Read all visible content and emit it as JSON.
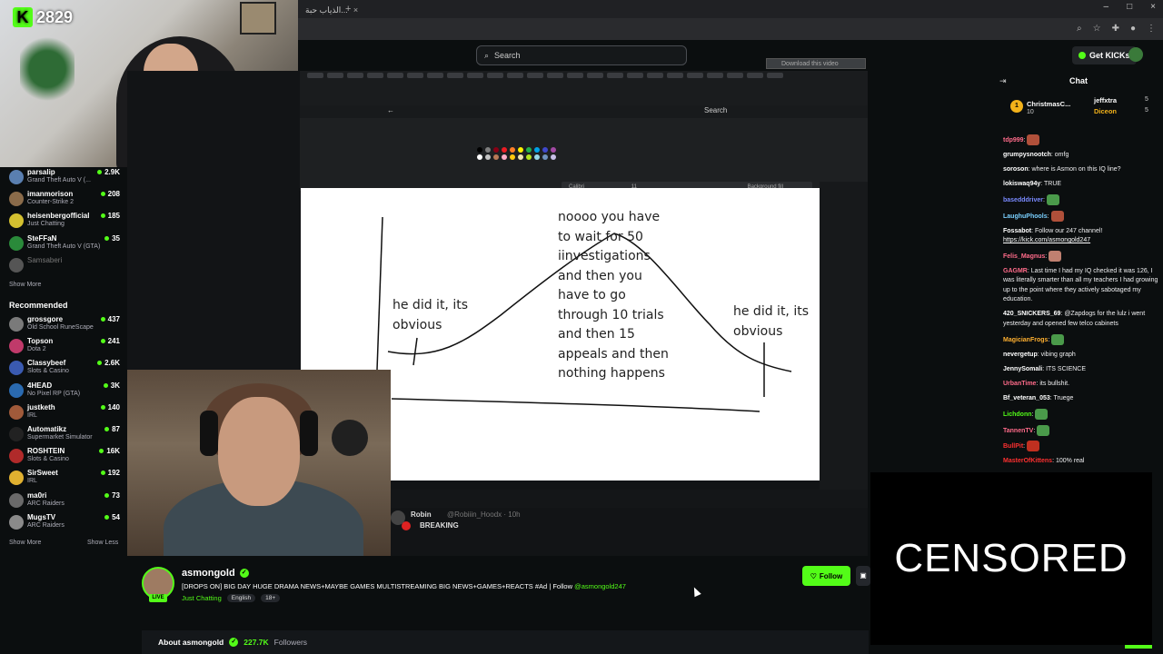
{
  "kicks": {
    "count": "2829"
  },
  "browser": {
    "tab_title": "الذياب حبة...",
    "tab_close": "×",
    "new_tab": "+",
    "min": "–",
    "max": "□",
    "close": "×"
  },
  "topbar": {
    "search_placeholder": "Search",
    "get_kicks": "Get KICKs"
  },
  "sidebar": {
    "following": [
      {
        "name": "parsalip",
        "category": "Grand Theft Auto V (...",
        "viewers": "2.9K",
        "color": "#5a7fb0"
      },
      {
        "name": "imanmorison",
        "category": "Counter-Strike 2",
        "viewers": "208",
        "color": "#8a6b4a"
      },
      {
        "name": "heisenbergofficial",
        "category": "Just Chatting",
        "viewers": "185",
        "color": "#d4c030"
      },
      {
        "name": "SteFFaN",
        "category": "Grand Theft Auto V (GTA)",
        "viewers": "35",
        "color": "#2a8a3a"
      },
      {
        "name": "Samsaberi",
        "category": "",
        "viewers": "",
        "color": "#555555"
      }
    ],
    "show_more_1": "Show More",
    "recommended_title": "Recommended",
    "recommended": [
      {
        "name": "grossgore",
        "category": "Old School RuneScape",
        "viewers": "437",
        "color": "#7a7a7a"
      },
      {
        "name": "Topson",
        "category": "Dota 2",
        "viewers": "241",
        "color": "#c03a6a"
      },
      {
        "name": "Classybeef",
        "category": "Slots & Casino",
        "viewers": "2.6K",
        "color": "#3a5ab0"
      },
      {
        "name": "4HEAD",
        "category": "No Pixel RP (GTA)",
        "viewers": "3K",
        "color": "#2a6ab0"
      },
      {
        "name": "justketh",
        "category": "IRL",
        "viewers": "140",
        "color": "#a05a3a"
      },
      {
        "name": "Automatikz",
        "category": "Supermarket Simulator",
        "viewers": "87",
        "color": "#222222"
      },
      {
        "name": "ROSHTEIN",
        "category": "Slots & Casino",
        "viewers": "16K",
        "color": "#b02a2a"
      },
      {
        "name": "SirSweet",
        "category": "IRL",
        "viewers": "192",
        "color": "#e0b030"
      },
      {
        "name": "ma0ri",
        "category": "ARC Raiders",
        "viewers": "73",
        "color": "#6a6a6a"
      },
      {
        "name": "MugsTV",
        "category": "ARC Raiders",
        "viewers": "54",
        "color": "#8a8a8a"
      }
    ],
    "show_more_2": "Show More",
    "show_less": "Show Less"
  },
  "video": {
    "download_badge": "Download this video",
    "paint_search": "Search",
    "font_name": "Calibri",
    "font_size": "11",
    "bg_fill": "Background fill",
    "canvas": {
      "left_text": "he did it, its\nobvious",
      "middle_text": "noooo you have\nto wait for 50\niinvestigations\nand then you\nhave to go\nthrough 10 trials\nand then 15\nappeals and then\nnothing happens",
      "right_text": "he did it, its\nobvious"
    },
    "tweet_name": "Robin",
    "tweet_handle": "@Robiiin_Hoodx · 10h",
    "tweet_text": "BREAKING",
    "paint_colors": [
      "#000000",
      "#7f7f7f",
      "#880015",
      "#ed1c24",
      "#ff7f27",
      "#fff200",
      "#22b14c",
      "#00a2e8",
      "#3f48cc",
      "#a349a4",
      "#ffffff",
      "#c3c3c3",
      "#b97a57",
      "#ffaec9",
      "#ffc90e",
      "#efe4b0",
      "#b5e61d",
      "#99d9ea",
      "#7092be",
      "#c8bfe7"
    ]
  },
  "stream": {
    "streamer": "asmongold",
    "live": "LIVE",
    "title": "[DROPS ON] BIG DAY HUGE DRAMA NEWS+MAYBE GAMES MULTISTREAMING BIG NEWS+GAMES+REACTS #Ad | Follow ",
    "title_handle": "@asmongold247",
    "category": "Just Chatting",
    "tags": [
      "English",
      "18+"
    ],
    "follow_label": "Follow",
    "about_label": "About asmongold",
    "followers_count": "227.7K",
    "followers_label": "Followers"
  },
  "chat": {
    "title": "Chat",
    "pinned": {
      "rank": "1",
      "name1": "ChristmasC...",
      "count1": "10",
      "name2": "jeffxtra",
      "count2": "5",
      "name3": "Diceon",
      "count3": "5"
    },
    "messages": [
      {
        "user": "tdp999",
        "color": "#ff6b8a",
        "text": "",
        "emote": "#b0503a"
      },
      {
        "user": "grumpysnootch",
        "color": "#ffffff",
        "text": "omfg",
        "emote": ""
      },
      {
        "user": "soroson",
        "color": "#ffffff",
        "text": "where is Asmon on this IQ line?",
        "emote": ""
      },
      {
        "user": "lokiswaq94y",
        "color": "#ffffff",
        "text": "TRUE",
        "emote": ""
      },
      {
        "user": "basedddriver",
        "color": "#7a8aff",
        "text": "",
        "emote": "#4a9a4a"
      },
      {
        "user": "LaughuPhools",
        "color": "#7ad0ff",
        "text": "",
        "emote": "#b0503a"
      },
      {
        "user": "Fossabot",
        "color": "#ffffff",
        "text": "Follow our 247 channel! ",
        "link": "https://kick.com/asmongold247",
        "emote": ""
      },
      {
        "user": "Felis_Magnus",
        "color": "#ff6b8a",
        "text": "",
        "emote": "#c08070"
      },
      {
        "user": "GAGMR",
        "color": "#ff6b8a",
        "text": "Last time I had my IQ checked it was 126, I was literally smarter than all my teachers I had growing up to the point where they actively sabotaged my education.",
        "emote": ""
      },
      {
        "user": "420_SNICKERS_69",
        "color": "#ffffff",
        "text": "@Zapdogs for the lulz i went yesterday and opened few telco cabinets",
        "emote": ""
      },
      {
        "user": "MagicianFrogs",
        "color": "#ffb030",
        "text": "",
        "emote": "#4a9a4a"
      },
      {
        "user": "nevergetup",
        "color": "#ffffff",
        "text": "vibing graph",
        "emote": ""
      },
      {
        "user": "JennySomali",
        "color": "#ffffff",
        "text": "ITS SCIENCE",
        "emote": ""
      },
      {
        "user": "UrbanTime",
        "color": "#ff6b8a",
        "text": "its bullshit.",
        "emote": ""
      },
      {
        "user": "Bf_veteran_053",
        "color": "#ffffff",
        "text": "Truege",
        "emote": ""
      },
      {
        "user": "Lichdonn",
        "color": "#53fc18",
        "text": "",
        "emote": "#4a9a4a"
      },
      {
        "user": "TannenTV",
        "color": "#ff6b8a",
        "text": "",
        "emote": "#4a9a4a"
      },
      {
        "user": "BullPit",
        "color": "#ff3030",
        "text": "",
        "emote": "#c03020"
      },
      {
        "user": "MasterOfKittens",
        "color": "#ff3030",
        "text": "100% real",
        "emote": ""
      }
    ]
  },
  "censored": {
    "label": "CENSORED"
  }
}
